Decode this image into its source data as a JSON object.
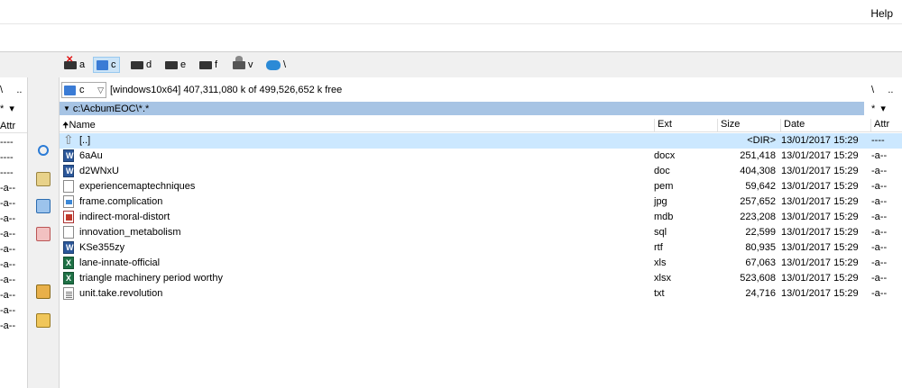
{
  "menu": {
    "help": "Help"
  },
  "drives": [
    {
      "letter": "a",
      "icon": "removed-drive-icon"
    },
    {
      "letter": "c",
      "icon": "system-drive-icon",
      "active": true
    },
    {
      "letter": "d",
      "icon": "drive-icon"
    },
    {
      "letter": "e",
      "icon": "drive-icon"
    },
    {
      "letter": "f",
      "icon": "drive-icon"
    },
    {
      "letter": "v",
      "icon": "network-drive-icon"
    },
    {
      "letter": "\\",
      "icon": "cloud-drive-icon"
    }
  ],
  "left_panel": {
    "nav": "\\     ..",
    "filter": "*  ▾",
    "attr_header": "Attr",
    "attrs": [
      "----",
      "----",
      "----",
      "-a--",
      "-a--",
      "-a--",
      "-a--",
      "-a--",
      "-a--",
      "-a--",
      "-a--",
      "-a--",
      "-a--"
    ]
  },
  "right_panel": {
    "drive_select": "c",
    "drive_info": "[windows10x64]  407,311,080 k of 499,526,652 k free",
    "path": "c:\\AcbumEOC\\*.*",
    "nav": "\\     ..",
    "filter": "*  ▾",
    "columns": {
      "name": "Name",
      "ext": "Ext",
      "size": "Size",
      "date": "Date",
      "attr": "Attr"
    },
    "rows": [
      {
        "name": "[..]",
        "ext": "",
        "size": "<DIR>",
        "date": "13/01/2017 15:29",
        "attr": "----",
        "icon": "up-folder-icon",
        "type": "up"
      },
      {
        "name": "6aAu",
        "ext": "docx",
        "size": "251,418",
        "date": "13/01/2017 15:29",
        "attr": "-a--",
        "icon": "word-file-icon",
        "type": "word"
      },
      {
        "name": "d2WNxU",
        "ext": "doc",
        "size": "404,308",
        "date": "13/01/2017 15:29",
        "attr": "-a--",
        "icon": "word-file-icon",
        "type": "word"
      },
      {
        "name": "experiencemaptechniques",
        "ext": "pem",
        "size": "59,642",
        "date": "13/01/2017 15:29",
        "attr": "-a--",
        "icon": "generic-file-icon",
        "type": ""
      },
      {
        "name": "frame.complication",
        "ext": "jpg",
        "size": "257,652",
        "date": "13/01/2017 15:29",
        "attr": "-a--",
        "icon": "image-file-icon",
        "type": "img"
      },
      {
        "name": "indirect-moral-distort",
        "ext": "mdb",
        "size": "223,208",
        "date": "13/01/2017 15:29",
        "attr": "-a--",
        "icon": "access-file-icon",
        "type": "mdb"
      },
      {
        "name": "innovation_metabolism",
        "ext": "sql",
        "size": "22,599",
        "date": "13/01/2017 15:29",
        "attr": "-a--",
        "icon": "generic-file-icon",
        "type": ""
      },
      {
        "name": "KSe355zy",
        "ext": "rtf",
        "size": "80,935",
        "date": "13/01/2017 15:29",
        "attr": "-a--",
        "icon": "word-file-icon",
        "type": "word"
      },
      {
        "name": "lane-innate-official",
        "ext": "xls",
        "size": "67,063",
        "date": "13/01/2017 15:29",
        "attr": "-a--",
        "icon": "excel-file-icon",
        "type": "xls"
      },
      {
        "name": "triangle machinery period worthy",
        "ext": "xlsx",
        "size": "523,608",
        "date": "13/01/2017 15:29",
        "attr": "-a--",
        "icon": "excel-file-icon",
        "type": "xls"
      },
      {
        "name": "unit.take.revolution",
        "ext": "txt",
        "size": "24,716",
        "date": "13/01/2017 15:29",
        "attr": "-a--",
        "icon": "text-file-icon",
        "type": "txt"
      }
    ]
  },
  "mid_toolbar": [
    "search-icon",
    "edit-icon",
    "copy-icon",
    "compare-icon",
    "pack-icon",
    "new-folder-icon"
  ]
}
